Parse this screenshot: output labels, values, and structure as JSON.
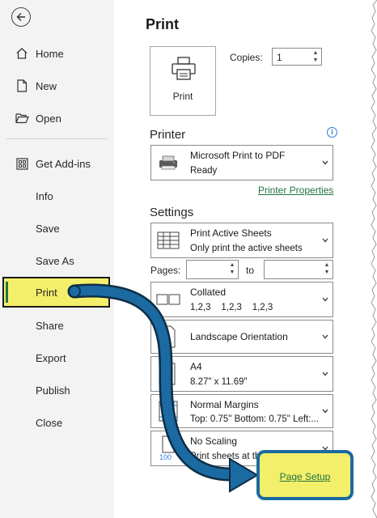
{
  "nav": {
    "back_icon": "back-arrow-icon",
    "items_top": [
      {
        "label": "Home",
        "icon": "home-icon"
      },
      {
        "label": "New",
        "icon": "new-document-icon"
      },
      {
        "label": "Open",
        "icon": "folder-open-icon"
      }
    ],
    "addins": {
      "label": "Get Add-ins",
      "icon": "add-ins-grid-icon"
    },
    "items_bottom": [
      {
        "label": "Info"
      },
      {
        "label": "Save"
      },
      {
        "label": "Save As"
      },
      {
        "label": "Print",
        "selected": true
      },
      {
        "label": "Share"
      },
      {
        "label": "Export"
      },
      {
        "label": "Publish"
      },
      {
        "label": "Close"
      }
    ]
  },
  "main": {
    "title": "Print",
    "print_button_label": "Print",
    "copies": {
      "label": "Copies:",
      "value": "1"
    },
    "printer": {
      "heading": "Printer",
      "name": "Microsoft Print to PDF",
      "status": "Ready",
      "properties_link": "Printer Properties"
    },
    "settings": {
      "heading": "Settings",
      "what": {
        "title": "Print Active Sheets",
        "subtitle": "Only print the active sheets"
      },
      "pages_label": "Pages:",
      "pages_from": "",
      "to_label": "to",
      "pages_to": "",
      "collation": {
        "title": "Collated",
        "subtitle": "1,2,3    1,2,3    1,2,3"
      },
      "orientation": {
        "title": "Landscape Orientation"
      },
      "paper": {
        "title": "A4",
        "subtitle": "8.27\" x 11.69\""
      },
      "margins": {
        "title": "Normal Margins",
        "subtitle": "Top: 0.75\" Bottom: 0.75\" Left:..."
      },
      "scaling": {
        "title": "No Scaling",
        "subtitle": "Print sheets at their actual size",
        "icon_text": "100"
      },
      "page_setup_link": "Page Setup"
    }
  },
  "colors": {
    "highlight": "#f4ef6a",
    "arrow": "#1b6aa1",
    "excel_green": "#217346",
    "sidebar_bg": "#f3f3f3"
  }
}
